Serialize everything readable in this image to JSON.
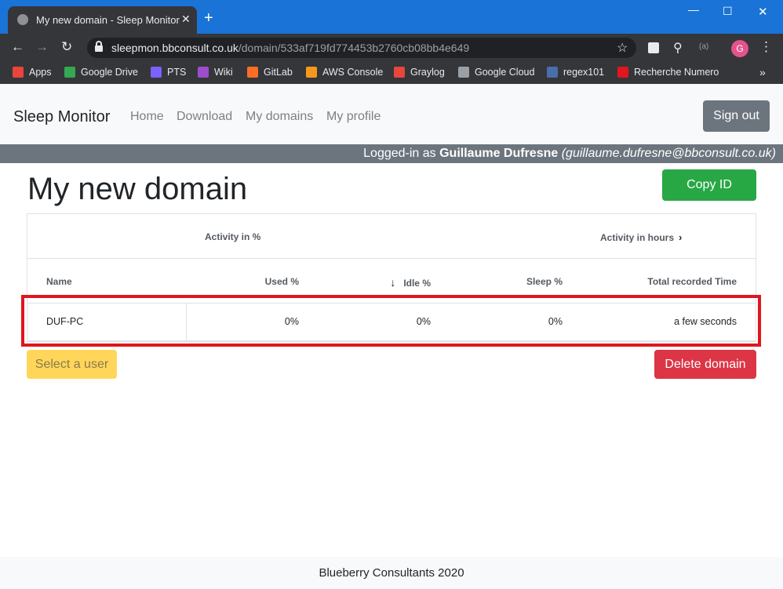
{
  "browser": {
    "tab_title": "My new domain - Sleep Monitor",
    "new_tab_label": "+",
    "window_controls": {
      "minimize": "—",
      "maximize": "☐",
      "close": "✕"
    },
    "nav": {
      "back": "←",
      "forward": "→",
      "reload": "↻"
    },
    "url_host": "sleepmon.bbconsult.co.uk",
    "url_path": "/domain/533af719fd774453b2760cb08bb4e649",
    "profile_initial": "G",
    "extension_label": "(a)",
    "bookmarks": [
      {
        "label": "Apps",
        "icon": "apps-grid-icon",
        "color": "#e8453c"
      },
      {
        "label": "Google Drive",
        "icon": "google-drive-icon",
        "color": "#34a853"
      },
      {
        "label": "PTS",
        "icon": "pts-icon",
        "color": "#7b61ff"
      },
      {
        "label": "Wiki",
        "icon": "wiki-icon",
        "color": "#9c4dcc"
      },
      {
        "label": "GitLab",
        "icon": "gitlab-icon",
        "color": "#fc6d26"
      },
      {
        "label": "AWS Console",
        "icon": "aws-icon",
        "color": "#f7981d"
      },
      {
        "label": "Graylog",
        "icon": "graylog-icon",
        "color": "#e8453c"
      },
      {
        "label": "Google Cloud",
        "icon": "google-cloud-icon",
        "color": "#9aa0a6"
      },
      {
        "label": "regex101",
        "icon": "regex101-icon",
        "color": "#4a6ea9"
      },
      {
        "label": "Recherche Numero",
        "icon": "recherche-numero-icon",
        "color": "#e0151e"
      }
    ],
    "bookmarks_more": "»"
  },
  "navbar": {
    "brand": "Sleep Monitor",
    "links": [
      "Home",
      "Download",
      "My domains",
      "My profile"
    ],
    "sign_out": "Sign out"
  },
  "logged_in": {
    "prefix": "Logged-in as ",
    "name": "Guillaume Dufresne",
    "email": "(guillaume.dufresne@bbconsult.co.uk)"
  },
  "page": {
    "title": "My new domain",
    "copy_id": "Copy ID"
  },
  "table": {
    "group_headers": {
      "activity_pct": "Activity in %",
      "activity_hours": "Activity in hours"
    },
    "columns": [
      "Name",
      "Used %",
      "Idle %",
      "Sleep %",
      "Total recorded Time"
    ],
    "sorted_column": "Idle %",
    "rows": [
      {
        "name": "DUF-PC",
        "used": "0%",
        "idle": "0%",
        "sleep": "0%",
        "total": "a few seconds"
      }
    ]
  },
  "actions": {
    "select_user": "Select a user",
    "delete_domain": "Delete domain"
  },
  "footer": {
    "text": "Blueberry Consultants    2020"
  },
  "colors": {
    "titlebar": "#1a73d6",
    "highlight": "#e0151e",
    "success": "#28a745",
    "danger": "#dc3545",
    "warning": "#ffd65a",
    "secondary": "#6c757d"
  }
}
